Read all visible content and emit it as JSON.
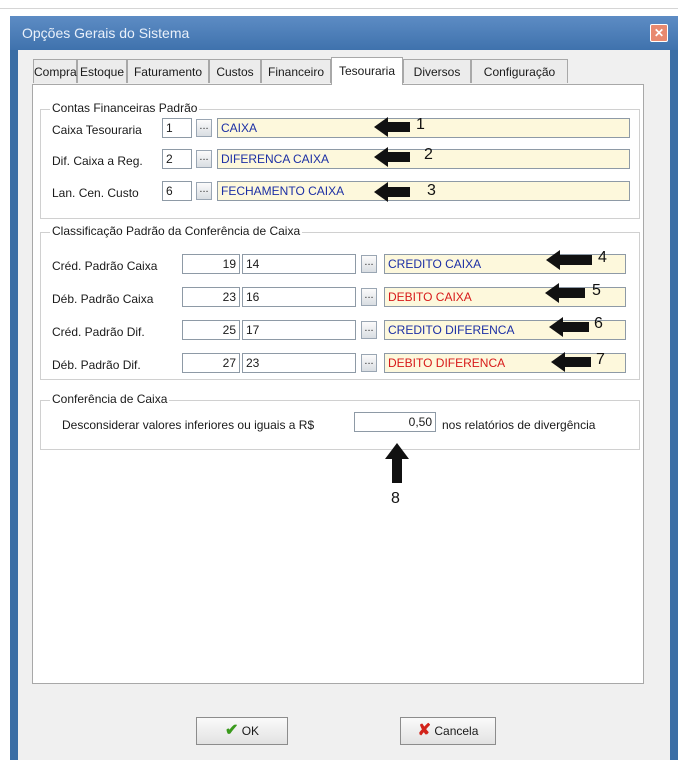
{
  "window": {
    "title": "Opções Gerais do Sistema",
    "close_glyph": "✕"
  },
  "tabs": [
    "Compras",
    "Estoque",
    "Faturamento",
    "Custos",
    "Financeiro",
    "Tesouraria",
    "Diversos",
    "Configuração"
  ],
  "active_tab": "Tesouraria",
  "contas": {
    "legend": "Contas Financeiras Padrão",
    "rows": [
      {
        "label": "Caixa Tesouraria",
        "code": "1",
        "name": "CAIXA",
        "marker": "1"
      },
      {
        "label": "Dif. Caixa a Reg.",
        "code": "2",
        "name": "DIFERENCA CAIXA",
        "marker": "2"
      },
      {
        "label": "Lan. Cen. Custo",
        "code": "6",
        "name": "FECHAMENTO CAIXA",
        "marker": "3"
      }
    ]
  },
  "classificacao": {
    "legend": "Classificação Padrão da Conferência de Caixa",
    "rows": [
      {
        "label": "Créd. Padrão Caixa",
        "num": "19",
        "code": "14",
        "name": "CREDITO CAIXA",
        "marker": "4"
      },
      {
        "label": "Déb. Padrão Caixa",
        "num": "23",
        "code": "16",
        "name": "DEBITO CAIXA",
        "marker": "5"
      },
      {
        "label": "Créd. Padrão Dif.",
        "num": "25",
        "code": "17",
        "name": "CREDITO DIFERENCA",
        "marker": "6"
      },
      {
        "label": "Déb. Padrão Dif.",
        "num": "27",
        "code": "23",
        "name": "DEBITO DIFERENCA",
        "marker": "7"
      }
    ]
  },
  "conferencia": {
    "legend": "Conferência de Caixa",
    "text_before": "Desconsiderar valores inferiores ou iguais a R$",
    "value": "0,50",
    "text_after": "nos relatórios de divergência",
    "marker": "8"
  },
  "buttons": {
    "ok": "OK",
    "cancel": "Cancela"
  },
  "colors": {
    "title_bar": "#3f72ad",
    "name_field_bg": "#fdf8dc",
    "blue_text": "#1c2fa5",
    "red_text": "#d71a1a"
  },
  "icons": {
    "ellipsis": "...",
    "ok_icon": "✔",
    "cancel_icon": "✘"
  }
}
